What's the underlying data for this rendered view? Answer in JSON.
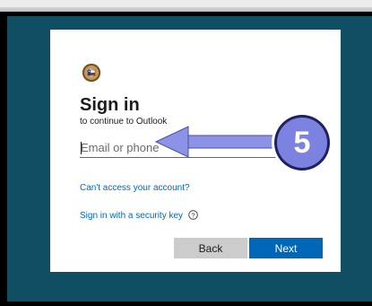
{
  "signin": {
    "title": "Sign in",
    "subtitle": "to continue to Outlook",
    "email_placeholder": "Email or phone",
    "cant_access_link": "Can't access your account?",
    "security_key_link": "Sign in with a security key",
    "back_label": "Back",
    "next_label": "Next"
  },
  "annotation": {
    "step_number": "5",
    "arrow_color": "#8c93e6",
    "badge_color": "#7b82df"
  },
  "colors": {
    "background": "#0f4e63",
    "primary_button": "#0067b8",
    "link": "#0067b8"
  },
  "icons": [
    "logo-seal-icon",
    "help-icon",
    "arrow-icon"
  ]
}
